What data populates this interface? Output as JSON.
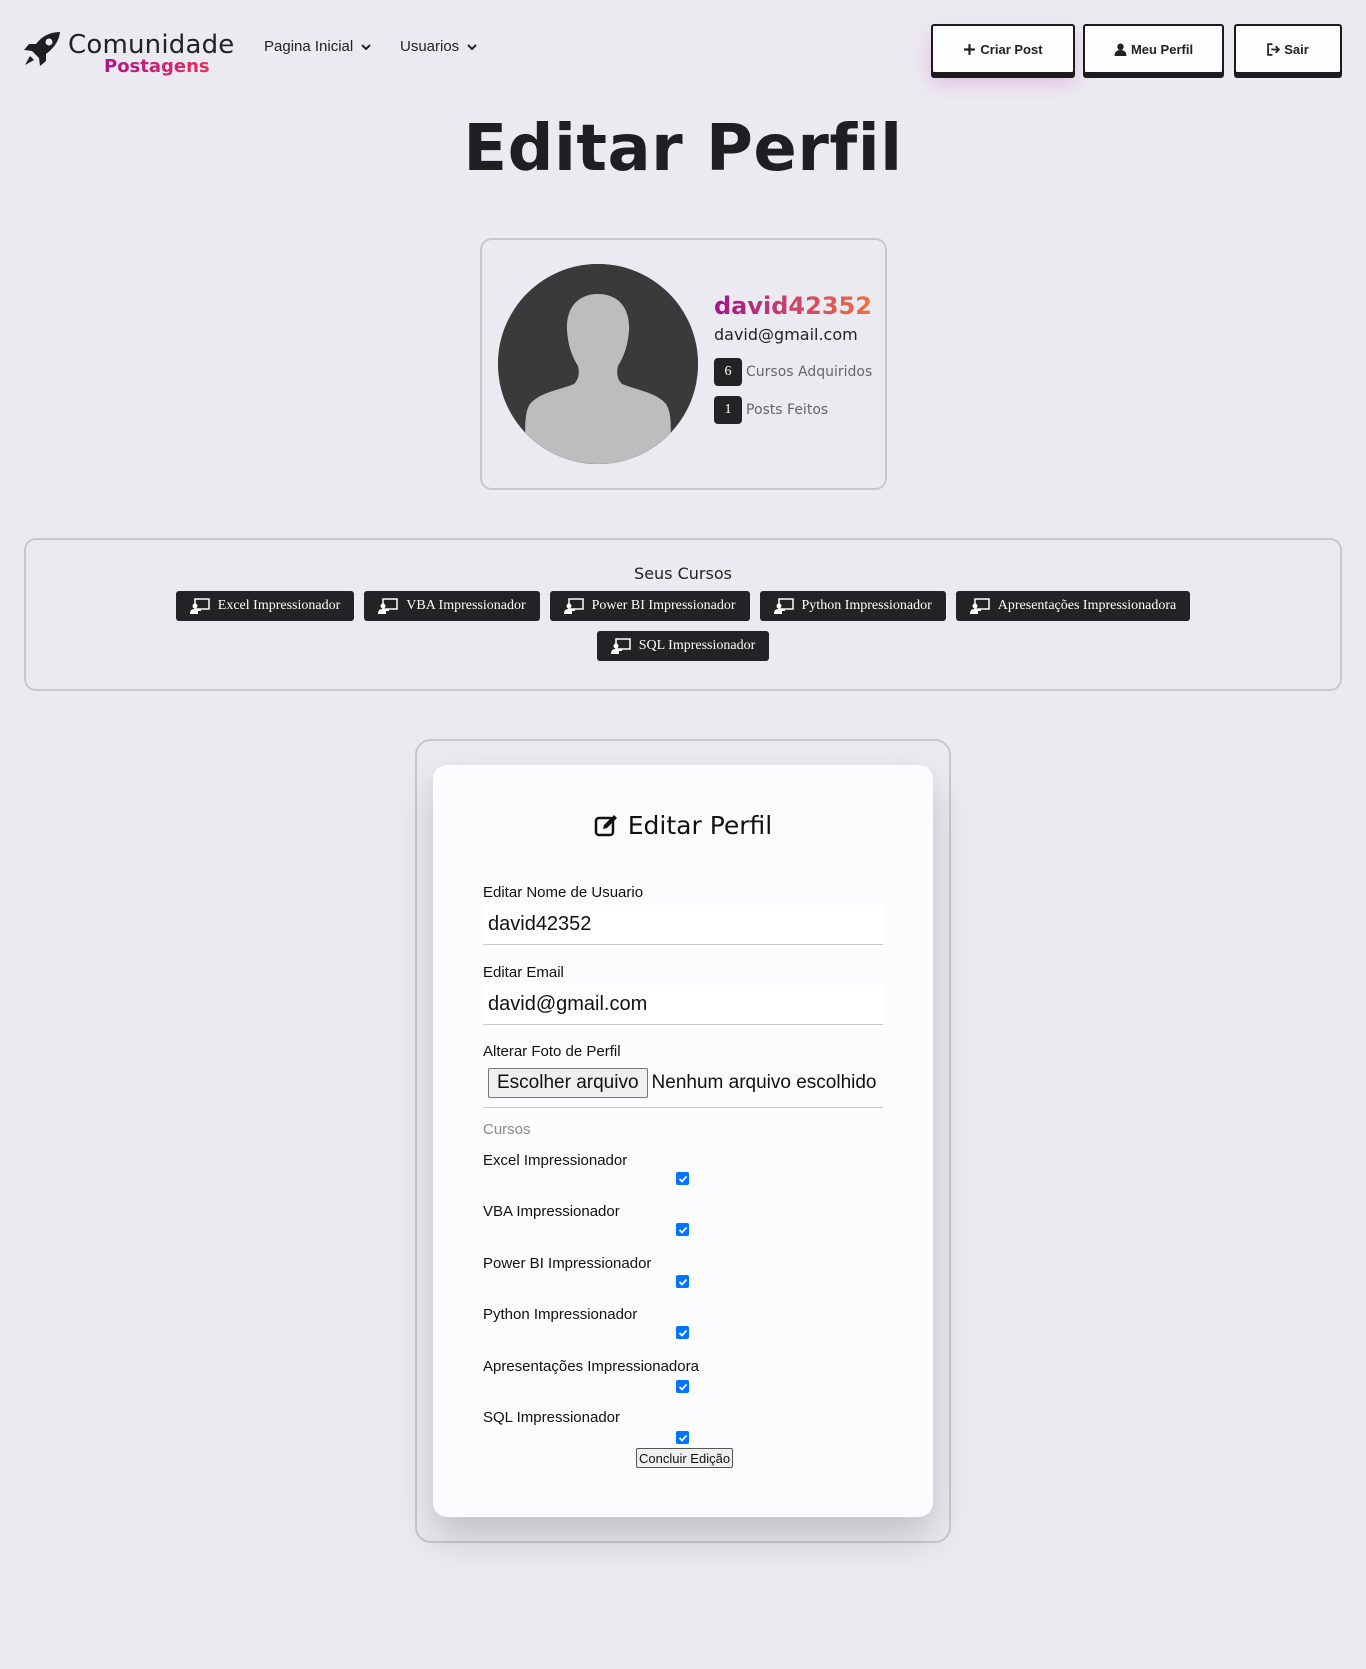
{
  "brand": {
    "line1": "Comunidade",
    "line2": "Postagens",
    "icon": "rocket-icon"
  },
  "nav": {
    "links": [
      {
        "label": "Pagina Inicial",
        "icon": "chevron-down-icon"
      },
      {
        "label": "Usuarios",
        "icon": "chevron-down-icon"
      }
    ],
    "buttons": [
      {
        "label": "Criar Post",
        "icon": "plus-icon"
      },
      {
        "label": "Meu Perfil",
        "icon": "user-icon"
      },
      {
        "label": "Sair",
        "icon": "sign-out-icon"
      }
    ]
  },
  "page": {
    "title": "Editar Perfil"
  },
  "profile": {
    "username": "david42352",
    "email": "david@gmail.com",
    "stats": [
      {
        "count": "6",
        "label": "Cursos Adquiridos"
      },
      {
        "count": "1",
        "label": "Posts Feitos"
      }
    ],
    "colors": {
      "name_gradient_start": "#a5148f",
      "name_gradient_end": "#f07040"
    }
  },
  "courses": {
    "title": "Seus Cursos",
    "items": [
      "Excel Impressionador",
      "VBA Impressionador",
      "Power BI Impressionador",
      "Python Impressionador",
      "Apresentações Impressionadora",
      "SQL Impressionador"
    ],
    "icon": "teacher-icon"
  },
  "form": {
    "heading": "Editar Perfil",
    "heading_icon": "edit-icon",
    "username_label": "Editar Nome de Usuario",
    "username_value": "david42352",
    "email_label": "Editar Email",
    "email_value": "david@gmail.com",
    "photo_label": "Alterar Foto de Perfil",
    "file_button": "Escolher arquivo",
    "file_status": "Nenhum arquivo escolhido",
    "courses_label": "Cursos",
    "course_checks": [
      {
        "label": "Excel Impressionador",
        "checked": true
      },
      {
        "label": "VBA Impressionador",
        "checked": true
      },
      {
        "label": "Power BI Impressionador",
        "checked": true
      },
      {
        "label": "Python Impressionador",
        "checked": true
      },
      {
        "label": "Apresentações Impressionadora",
        "checked": true
      },
      {
        "label": "SQL Impressionador",
        "checked": true
      }
    ],
    "submit_label": "Concluir Edição"
  },
  "colors": {
    "background": "#ebeaf0",
    "dark": "#232326",
    "checkbox": "#0075ff"
  }
}
